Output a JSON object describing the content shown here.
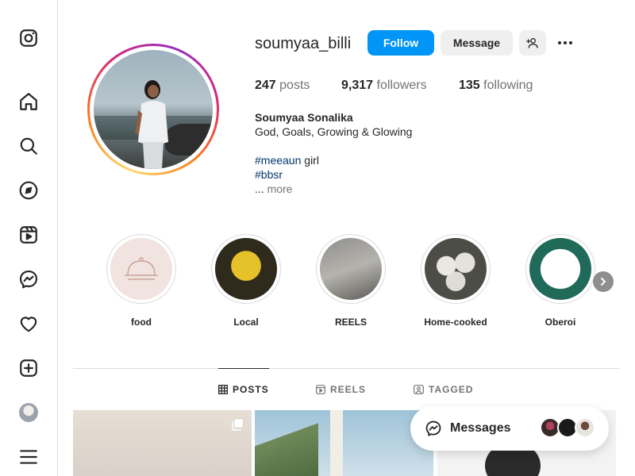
{
  "profile": {
    "username": "soumyaa_billi",
    "follow_label": "Follow",
    "message_label": "Message",
    "stats": {
      "posts_count": "247",
      "posts_label": "posts",
      "followers_count": "9,317",
      "followers_label": "followers",
      "following_count": "135",
      "following_label": "following"
    },
    "bio": {
      "name": "Soumyaa Sonalika",
      "line1": "God, Goals, Growing & Glowing",
      "line2": "",
      "hashtag1": "#meeaun",
      "hashtag1_suffix": " girl",
      "hashtag2": "#bbsr",
      "ellipsis": "... ",
      "more_label": "more"
    }
  },
  "highlights": [
    {
      "label": "food"
    },
    {
      "label": "Local"
    },
    {
      "label": "REELS"
    },
    {
      "label": "Home-cooked"
    },
    {
      "label": "Oberoi "
    }
  ],
  "tabs": [
    {
      "label": "POSTS",
      "active": true
    },
    {
      "label": "REELS",
      "active": false
    },
    {
      "label": "TAGGED",
      "active": false
    }
  ],
  "messages_bar": {
    "label": "Messages"
  },
  "sidebar": {
    "items": [
      "instagram-logo",
      "home",
      "search",
      "explore",
      "reels",
      "messenger",
      "notifications",
      "create",
      "profile",
      "more"
    ]
  },
  "colors": {
    "accent": "#0095f6",
    "text": "#262626",
    "muted": "#737373",
    "border": "#dbdbdb"
  }
}
